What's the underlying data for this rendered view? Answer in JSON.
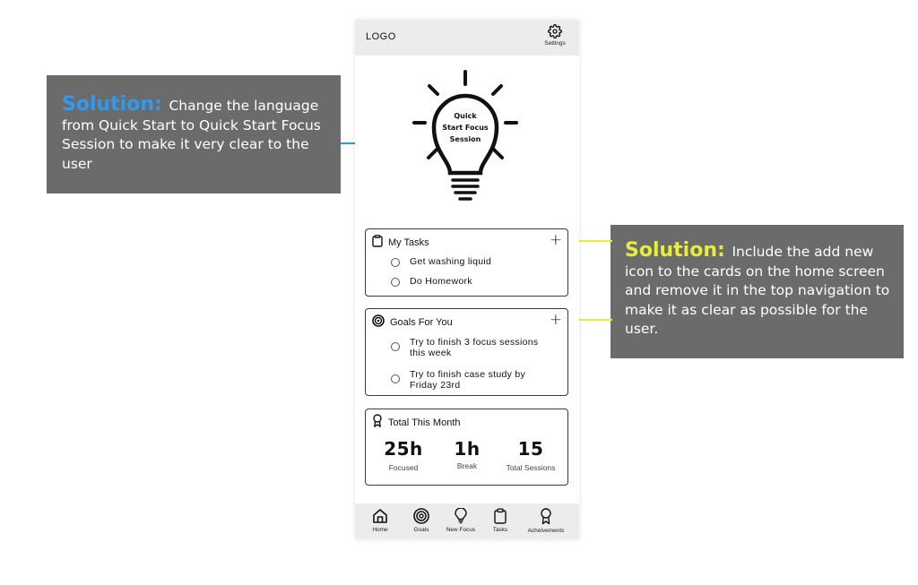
{
  "header": {
    "logo": "LOGO",
    "settings_label": "Settings",
    "settings_icon": "gear-icon"
  },
  "hero": {
    "icon": "lightbulb-icon",
    "label_line1": "Quick",
    "label_line2": "Start Focus",
    "label_line3": "Session"
  },
  "tasks_card": {
    "icon": "clipboard-icon",
    "title": "My Tasks",
    "add_icon": "plus-icon",
    "items": [
      {
        "label": "Get washing liquid",
        "checked": false
      },
      {
        "label": "Do Homework",
        "checked": false
      }
    ]
  },
  "goals_card": {
    "icon": "target-icon",
    "title": "Goals For You",
    "add_icon": "plus-icon",
    "items": [
      {
        "label_line1": "Try to finish 3 focus sessions",
        "label_line2": "this week",
        "checked": false
      },
      {
        "label_line1": "Try to finish case study by",
        "label_line2": "Friday 23rd",
        "checked": false
      }
    ]
  },
  "total_card": {
    "icon": "award-icon",
    "title": "Total This Month",
    "stats": [
      {
        "value": "25h",
        "caption": "Focused"
      },
      {
        "value": "1h",
        "caption": "Break"
      },
      {
        "value": "15",
        "caption": "Total Sessions"
      }
    ]
  },
  "bottom_nav": {
    "items": [
      {
        "label": "Home",
        "icon": "home-icon"
      },
      {
        "label": "Goals",
        "icon": "target-icon"
      },
      {
        "label": "New Focus",
        "icon": "lightbulb-icon"
      },
      {
        "label": "Tasks",
        "icon": "clipboard-icon"
      },
      {
        "label": "Achelvements",
        "icon": "award-icon"
      }
    ]
  },
  "annotations": {
    "left": {
      "heading": "Solution:",
      "body": "Change the language from Quick Start to Quick Start Focus Session to make it very clear to the user",
      "heading_color": "#2e9af0",
      "arrow_color": "#2e9af0"
    },
    "right": {
      "heading": "Solution:",
      "body": "Include the add new icon to the cards on the home screen and remove it in the top navigation to make it as clear as possible for the user.",
      "heading_color": "#e8ec3a",
      "arrow_color": "#e8ec3a"
    }
  }
}
